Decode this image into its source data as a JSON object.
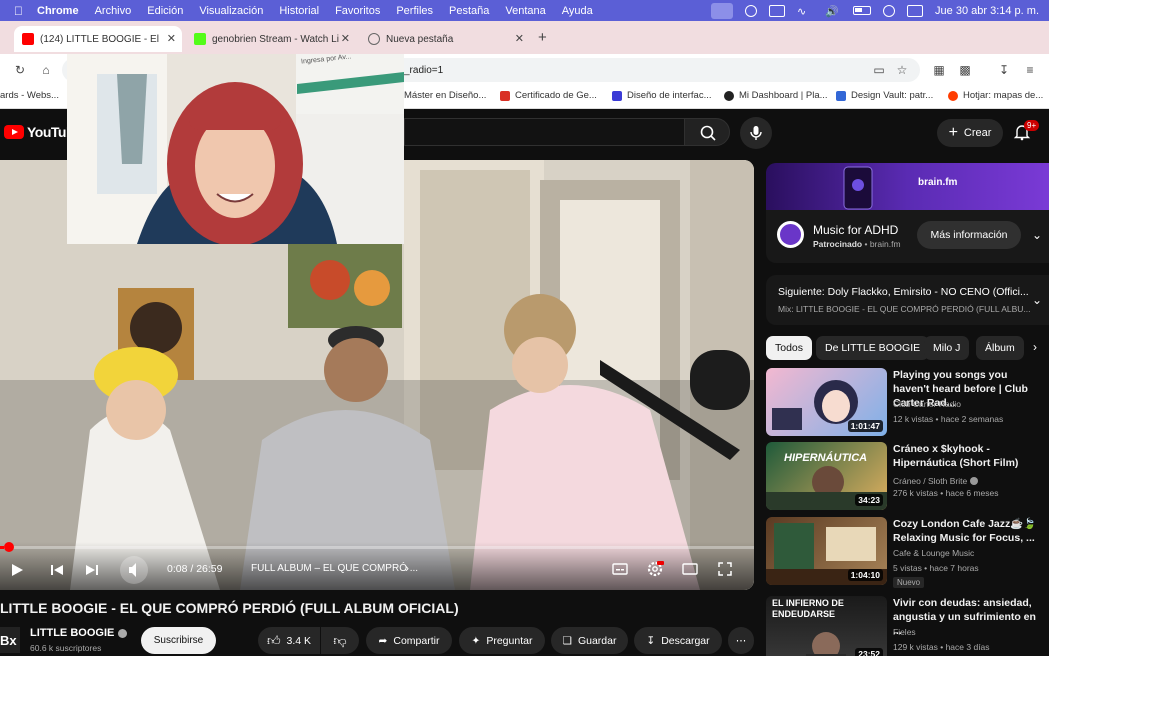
{
  "menubar": {
    "app": "Chrome",
    "items": [
      "Archivo",
      "Edición",
      "Visualización",
      "Historial",
      "Favoritos",
      "Perfiles",
      "Pestaña",
      "Ventana",
      "Ayuda"
    ],
    "clock": "Jue 30 abr  3:14 p. m."
  },
  "tabs": [
    {
      "label": "(124) LITTLE BOOGIE - El"
    },
    {
      "label": "genobrien Stream - Watch Li"
    },
    {
      "label": "Nueva pestaña"
    }
  ],
  "omnibox": {
    "text": "_radio=1"
  },
  "bookmarks": [
    "ards - Webs...",
    "Máster en Diseño...",
    "Certificado de Ge...",
    "Diseño de interfac...",
    "Mi Dashboard | Pla...",
    "Design Vault: patr...",
    "Hotjar: mapas de..."
  ],
  "youtube": {
    "logo": "YouTube",
    "create_label": "Crear",
    "bell_badge": "9+"
  },
  "player": {
    "time": "0:08 / 26:59",
    "chapter": "FULL ALBUM – EL QUE COMPRÓ ...",
    "progress": 0.005
  },
  "webcam": {
    "sign_text": "Ingresa por Av..."
  },
  "video_info": {
    "title": "LITTLE BOOGIE - EL QUE COMPRÓ PERDIÓ (FULL ALBUM OFICIAL)",
    "avatar_text": "Bx",
    "channel": "LITTLE BOOGIE",
    "subs": "60.6 k suscriptores",
    "subscribe": "Suscribirse",
    "likes": "3.4 K",
    "share": "Compartir",
    "ask": "Preguntar",
    "save": "Guardar",
    "download": "Descargar"
  },
  "ad": {
    "logo": "brain.fm",
    "title": "Music for ADHD",
    "sponsored": "Patrocinado",
    "advertiser": "brain.fm",
    "button": "Más información"
  },
  "up_next": {
    "title": "Siguiente: Doly Flackko, Emirsito - NO CENO (Offici...",
    "subtitle": "Mix: LITTLE BOOGIE - EL QUE COMPRÓ PERDIÓ (FULL ALBU..."
  },
  "chips": [
    "Todos",
    "De LITTLE BOOGIE",
    "Milo J",
    "Álbum"
  ],
  "recommendations": [
    {
      "title": "Playing you songs you haven't heard before | Club Carter Rad...",
      "channel": "Club Carter Radio",
      "meta": "12 k vistas • hace 2 semanas",
      "duration": "1:01:47",
      "verified": false,
      "badge": ""
    },
    {
      "title": "Cráneo x $kyhook - Hipernáutica (Short Film)",
      "channel": "Cráneo / Sloth Brite",
      "meta": "276 k vistas • hace 6 meses",
      "duration": "34:23",
      "verified": true,
      "badge": "",
      "thumb_text": "HIPERNÁUTICA"
    },
    {
      "title": "Cozy London Cafe Jazz☕🍃 Relaxing Music for Focus, ...",
      "channel": "Cafe & Lounge Music",
      "meta": "5 vistas • hace 7 horas",
      "duration": "1:04:10",
      "verified": false,
      "badge": "Nuevo"
    },
    {
      "title": "Vivir con deudas: ansiedad, angustia y un sufrimiento en ...",
      "channel": "Fieles",
      "meta": "129 k vistas • hace 3 días",
      "duration": "23:52",
      "verified": false,
      "badge": "",
      "thumb_text": "EL INFIERNO DE\nENDEUDARSE"
    }
  ],
  "colors": {
    "menubar": "#5b5fd6",
    "tabstrip": "#f1dde0",
    "yt_bg": "#0f0f0f",
    "yt_red": "#ff0000"
  }
}
